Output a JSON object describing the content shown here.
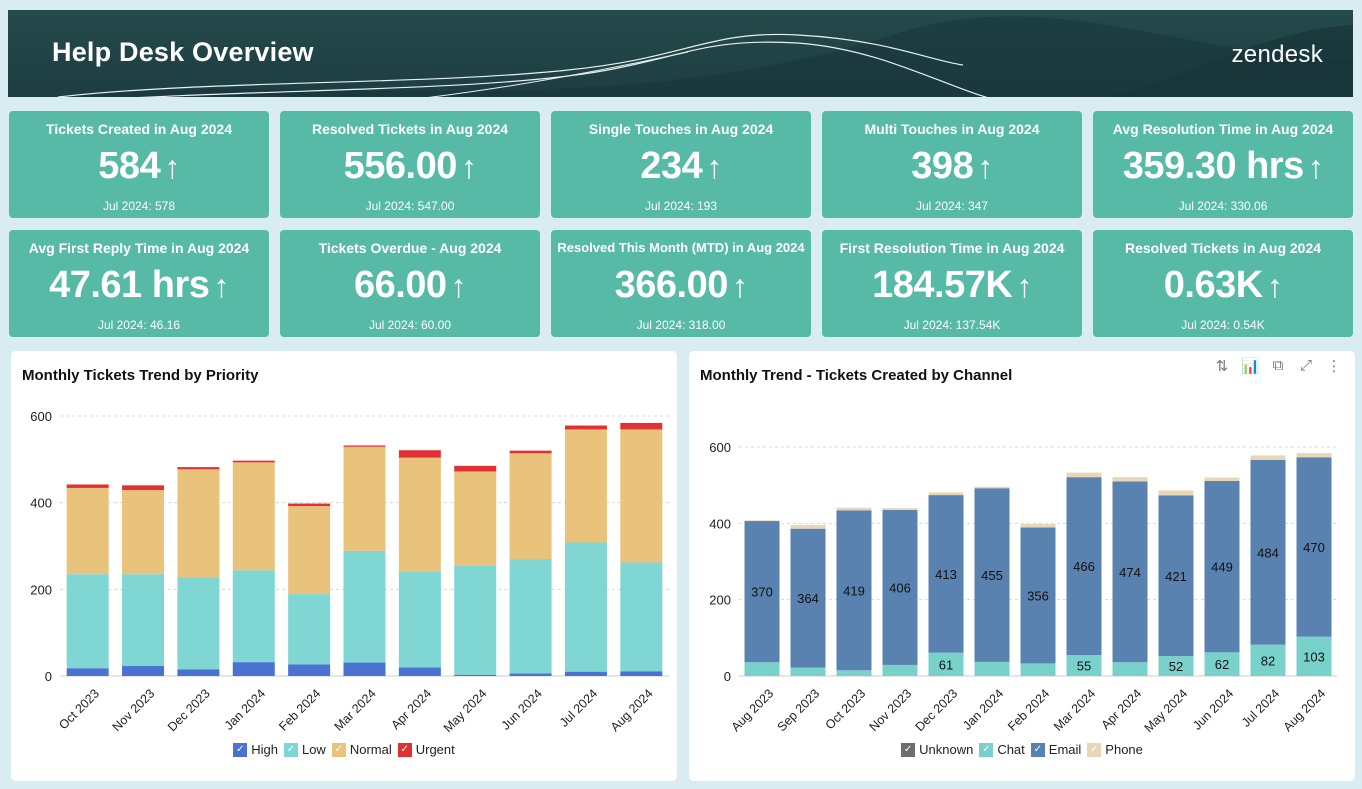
{
  "header": {
    "title": "Help Desk Overview",
    "logo": "zendesk"
  },
  "kpis": [
    {
      "title": "Tickets Created in Aug 2024",
      "value": "584",
      "trend": "↑",
      "previous": "Jul 2024: 578"
    },
    {
      "title": "Resolved Tickets in Aug 2024",
      "value": "556.00",
      "trend": "↑",
      "previous": "Jul 2024: 547.00"
    },
    {
      "title": "Single Touches in Aug 2024",
      "value": "234",
      "trend": "↑",
      "previous": "Jul 2024: 193"
    },
    {
      "title": "Multi Touches in Aug 2024",
      "value": "398",
      "trend": "↑",
      "previous": "Jul 2024: 347"
    },
    {
      "title": "Avg Resolution Time in Aug 2024",
      "value": "359.30 hrs",
      "trend": "↑",
      "previous": "Jul 2024: 330.06"
    },
    {
      "title": "Avg First Reply Time in Aug 2024",
      "value": "47.61 hrs",
      "trend": "↑",
      "previous": "Jul 2024: 46.16"
    },
    {
      "title": "Tickets Overdue - Aug 2024",
      "value": "66.00",
      "trend": "↑",
      "previous": "Jul 2024: 60.00"
    },
    {
      "title": "Resolved This Month (MTD) in Aug 2024",
      "value": "366.00",
      "trend": "↑",
      "previous": "Jul 2024: 318.00"
    },
    {
      "title": "First Resolution Time in Aug 2024",
      "value": "184.57K",
      "trend": "↑",
      "previous": "Jul 2024: 137.54K"
    },
    {
      "title": "Resolved Tickets in Aug 2024",
      "value": "0.63K",
      "trend": "↑",
      "previous": "Jul 2024: 0.54K"
    }
  ],
  "toolbar_icons": [
    "sort-icon",
    "chart-type-icon",
    "open-external-icon",
    "expand-icon",
    "more-options-icon"
  ],
  "toolbar_glyphs": [
    "⇅",
    "📊",
    "⧉",
    "⤢",
    "⋮"
  ],
  "chart_data": [
    {
      "type": "bar",
      "stacked": true,
      "title": "Monthly Tickets Trend by Priority",
      "xlabel": "",
      "ylabel": "",
      "ylim": [
        0,
        600
      ],
      "yticks": [
        0,
        200,
        400,
        600
      ],
      "grid": true,
      "legend_position": "bottom",
      "categories": [
        "Oct 2023",
        "Nov 2023",
        "Dec 2023",
        "Jan 2024",
        "Feb 2024",
        "Mar 2024",
        "Apr 2024",
        "May 2024",
        "Jun 2024",
        "Jul 2024",
        "Aug 2024"
      ],
      "series": [
        {
          "name": "High",
          "color": "#4a72d1",
          "values": [
            18,
            23,
            15,
            32,
            27,
            31,
            20,
            3,
            6,
            10,
            11
          ]
        },
        {
          "name": "Low",
          "color": "#7fd6d3",
          "values": [
            217,
            212,
            213,
            212,
            162,
            258,
            221,
            251,
            264,
            298,
            251
          ]
        },
        {
          "name": "Normal",
          "color": "#e9c37b",
          "values": [
            199,
            194,
            249,
            249,
            203,
            240,
            263,
            218,
            244,
            261,
            307
          ]
        },
        {
          "name": "Urgent",
          "color": "#e03234",
          "values": [
            8,
            11,
            5,
            4,
            6,
            3,
            17,
            13,
            6,
            9,
            15
          ]
        }
      ]
    },
    {
      "type": "bar",
      "stacked": true,
      "title": "Monthly Trend - Tickets Created by Channel",
      "xlabel": "",
      "ylabel": "",
      "ylim": [
        0,
        600
      ],
      "yticks": [
        0,
        200,
        400,
        600
      ],
      "grid": true,
      "legend_position": "bottom",
      "categories": [
        "Aug 2023",
        "Sep 2023",
        "Oct 2023",
        "Nov 2023",
        "Dec 2023",
        "Jan 2024",
        "Feb 2024",
        "Mar 2024",
        "Apr 2024",
        "May 2024",
        "Jun 2024",
        "Jul 2024",
        "Aug 2024"
      ],
      "series": [
        {
          "name": "Unknown",
          "color": "#6e6e6e",
          "values": [
            0,
            0,
            0,
            0,
            0,
            0,
            0,
            0,
            0,
            0,
            0,
            0,
            0
          ]
        },
        {
          "name": "Chat",
          "color": "#79d1cc",
          "values": [
            36,
            22,
            15,
            29,
            61,
            37,
            33,
            55,
            36,
            52,
            62,
            82,
            103
          ],
          "labels": [
            null,
            null,
            null,
            null,
            "61",
            null,
            null,
            "55",
            null,
            "52",
            "62",
            "82",
            "103"
          ]
        },
        {
          "name": "Email",
          "color": "#5a82b0",
          "values": [
            370,
            364,
            419,
            406,
            413,
            455,
            356,
            466,
            474,
            421,
            449,
            484,
            470
          ],
          "labels": [
            "370",
            "364",
            "419",
            "406",
            "413",
            "455",
            "356",
            "466",
            "474",
            "421",
            "449",
            "484",
            "470"
          ]
        },
        {
          "name": "Phone",
          "color": "#e8d7b6",
          "values": [
            2,
            10,
            7,
            5,
            7,
            4,
            9,
            12,
            11,
            13,
            9,
            12,
            11
          ]
        }
      ]
    }
  ]
}
